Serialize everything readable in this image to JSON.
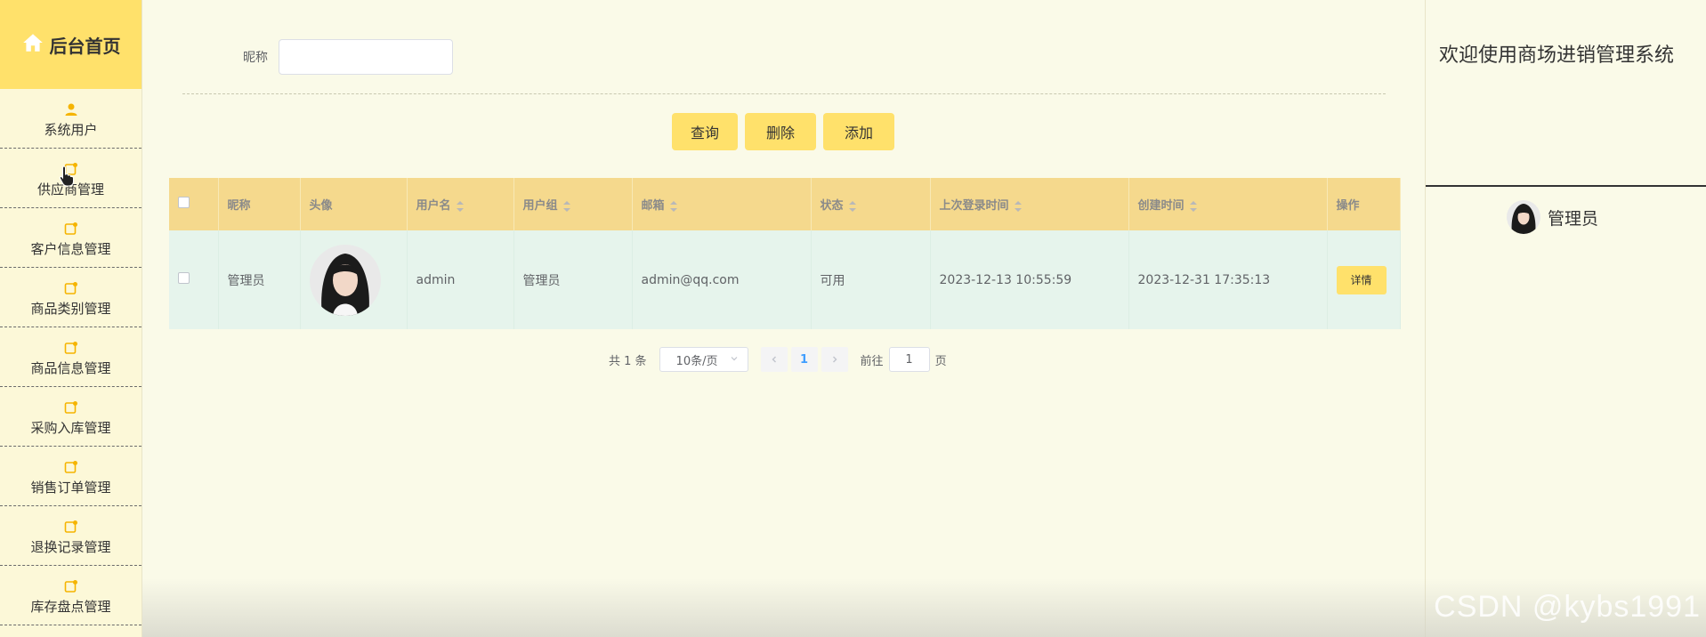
{
  "sidebar": {
    "home_label": "后台首页",
    "items": [
      {
        "label": "系统用户",
        "icon": "user-icon"
      },
      {
        "label": "供应商管理",
        "icon": "edit-icon"
      },
      {
        "label": "客户信息管理",
        "icon": "edit-icon"
      },
      {
        "label": "商品类别管理",
        "icon": "edit-icon"
      },
      {
        "label": "商品信息管理",
        "icon": "edit-icon"
      },
      {
        "label": "采购入库管理",
        "icon": "edit-icon"
      },
      {
        "label": "销售订单管理",
        "icon": "edit-icon"
      },
      {
        "label": "退换记录管理",
        "icon": "edit-icon"
      },
      {
        "label": "库存盘点管理",
        "icon": "edit-icon"
      }
    ]
  },
  "search": {
    "label": "昵称",
    "value": ""
  },
  "buttons": {
    "query": "查询",
    "delete": "删除",
    "add": "添加"
  },
  "table": {
    "headers": [
      "昵称",
      "头像",
      "用户名",
      "用户组",
      "邮箱",
      "状态",
      "上次登录时间",
      "创建时间",
      "操作"
    ],
    "rows": [
      {
        "nickname": "管理员",
        "username": "admin",
        "group": "管理员",
        "email": "admin@qq.com",
        "status": "可用",
        "last_login": "2023-12-13 10:55:59",
        "created": "2023-12-31 17:35:13",
        "action": "详情"
      }
    ]
  },
  "pagination": {
    "total": "共 1 条",
    "page_size": "10条/页",
    "current_page": "1",
    "goto_label": "前往",
    "goto_value": "1",
    "page_suffix": "页"
  },
  "header": {
    "welcome": "欢迎使用商场进销管理系统",
    "user_name": "管理员"
  },
  "watermark": "CSDN @kybs1991",
  "colors": {
    "accent": "#ffe16b",
    "table_header": "#f5d98d",
    "table_row": "#e6f4ec",
    "background": "#fafae8"
  }
}
